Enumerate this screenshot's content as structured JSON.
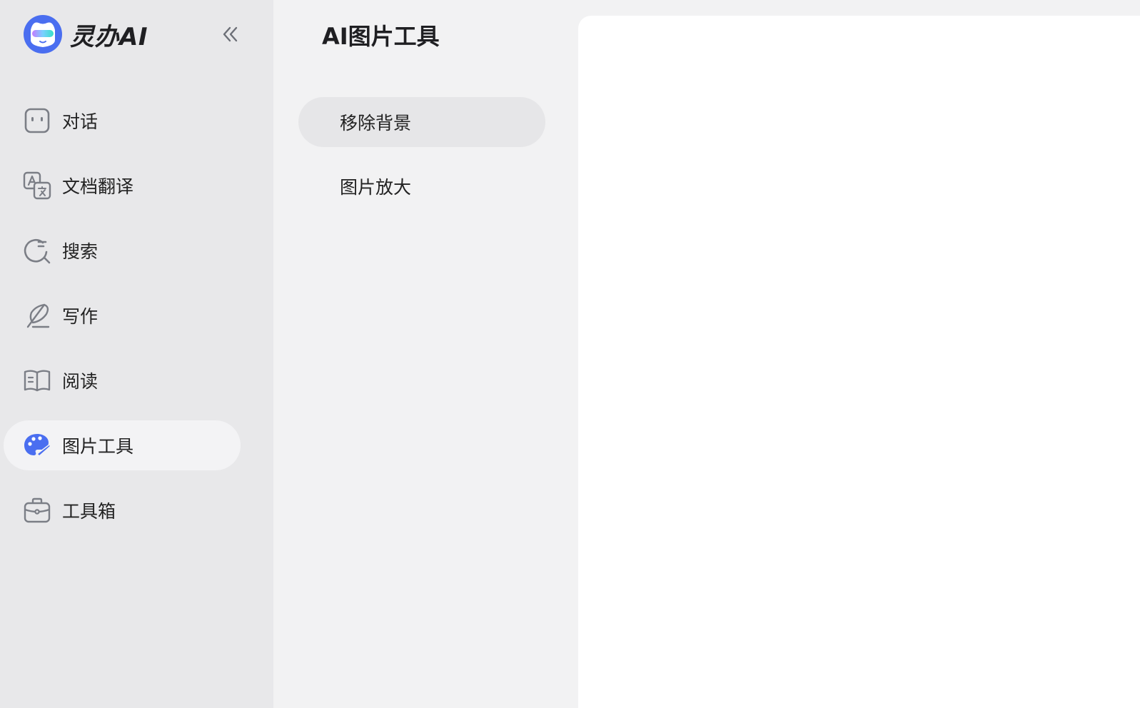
{
  "brand": {
    "name": "灵办AI",
    "logo_icon": "ai-mascot-logo"
  },
  "sidebar": {
    "collapse_icon": "double-chevron-left-icon",
    "items": [
      {
        "label": "对话",
        "icon": "chat-bot-icon",
        "active": false
      },
      {
        "label": "文档翻译",
        "icon": "translate-icon",
        "active": false
      },
      {
        "label": "搜索",
        "icon": "search-icon",
        "active": false
      },
      {
        "label": "写作",
        "icon": "feather-pen-icon",
        "active": false
      },
      {
        "label": "阅读",
        "icon": "open-book-icon",
        "active": false
      },
      {
        "label": "图片工具",
        "icon": "palette-icon",
        "active": true
      },
      {
        "label": "工具箱",
        "icon": "toolbox-icon",
        "active": false
      }
    ]
  },
  "panel": {
    "title": "AI图片工具",
    "items": [
      {
        "label": "移除背景",
        "active": true
      },
      {
        "label": "图片放大",
        "active": false
      }
    ]
  },
  "colors": {
    "sidebar_bg": "#e8e8ea",
    "panel_bg": "#f2f2f3",
    "accent_blue": "#4a6ef0",
    "icon_gray": "#7b7e86",
    "content_bg": "#ffffff"
  }
}
